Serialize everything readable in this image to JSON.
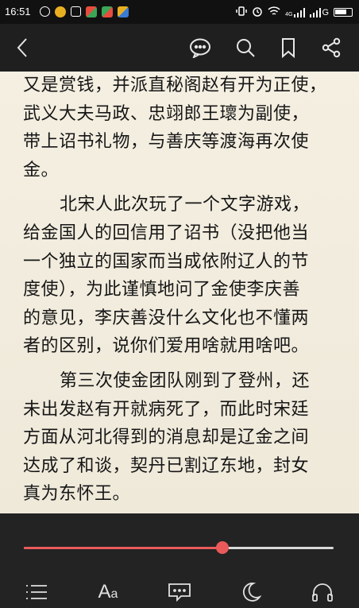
{
  "status_bar": {
    "time": "16:51",
    "network_label": "4G",
    "carrier_label": "G"
  },
  "toolbar": {
    "icons": [
      "back-icon",
      "comment-bubble-icon",
      "search-icon",
      "bookmark-icon",
      "share-icon"
    ]
  },
  "reader": {
    "paragraphs": [
      {
        "indent": false,
        "lines": [
          "又是赏钱，并派直秘阁赵有开为正使，",
          "武义大夫马政、忠翊郎王瓌为副使，",
          "带上诏书礼物，与善庆等渡海再次使",
          "金。"
        ]
      },
      {
        "indent": true,
        "lines": [
          "北宋人此次玩了一个文字游戏，",
          "给金国人的回信用了诏书（没把他当",
          "一个独立的国家而当成依附辽人的节",
          "度使），为此谨慎地问了金使李庆善",
          "的意见，李庆善没什么文化也不懂两",
          "者的区别，说你们爱用啥就用啥吧。"
        ]
      },
      {
        "indent": true,
        "lines": [
          "第三次使金团队刚到了登州，还",
          "未出发赵有开就病死了，而此时宋廷",
          "方面从河北得到的消息却是辽金之间",
          "达成了和谈，契丹已割辽东地，封女",
          "真为东怀王。"
        ]
      }
    ]
  },
  "progress": {
    "fraction": 0.64,
    "accent_color": "#ea5a5a"
  },
  "bottom_nav": {
    "font_button_label": "A",
    "font_button_small": "a",
    "icons": [
      "table-of-contents-icon",
      "font-size-icon",
      "comment-icon",
      "night-mode-moon-icon",
      "listen-headphones-icon"
    ]
  }
}
